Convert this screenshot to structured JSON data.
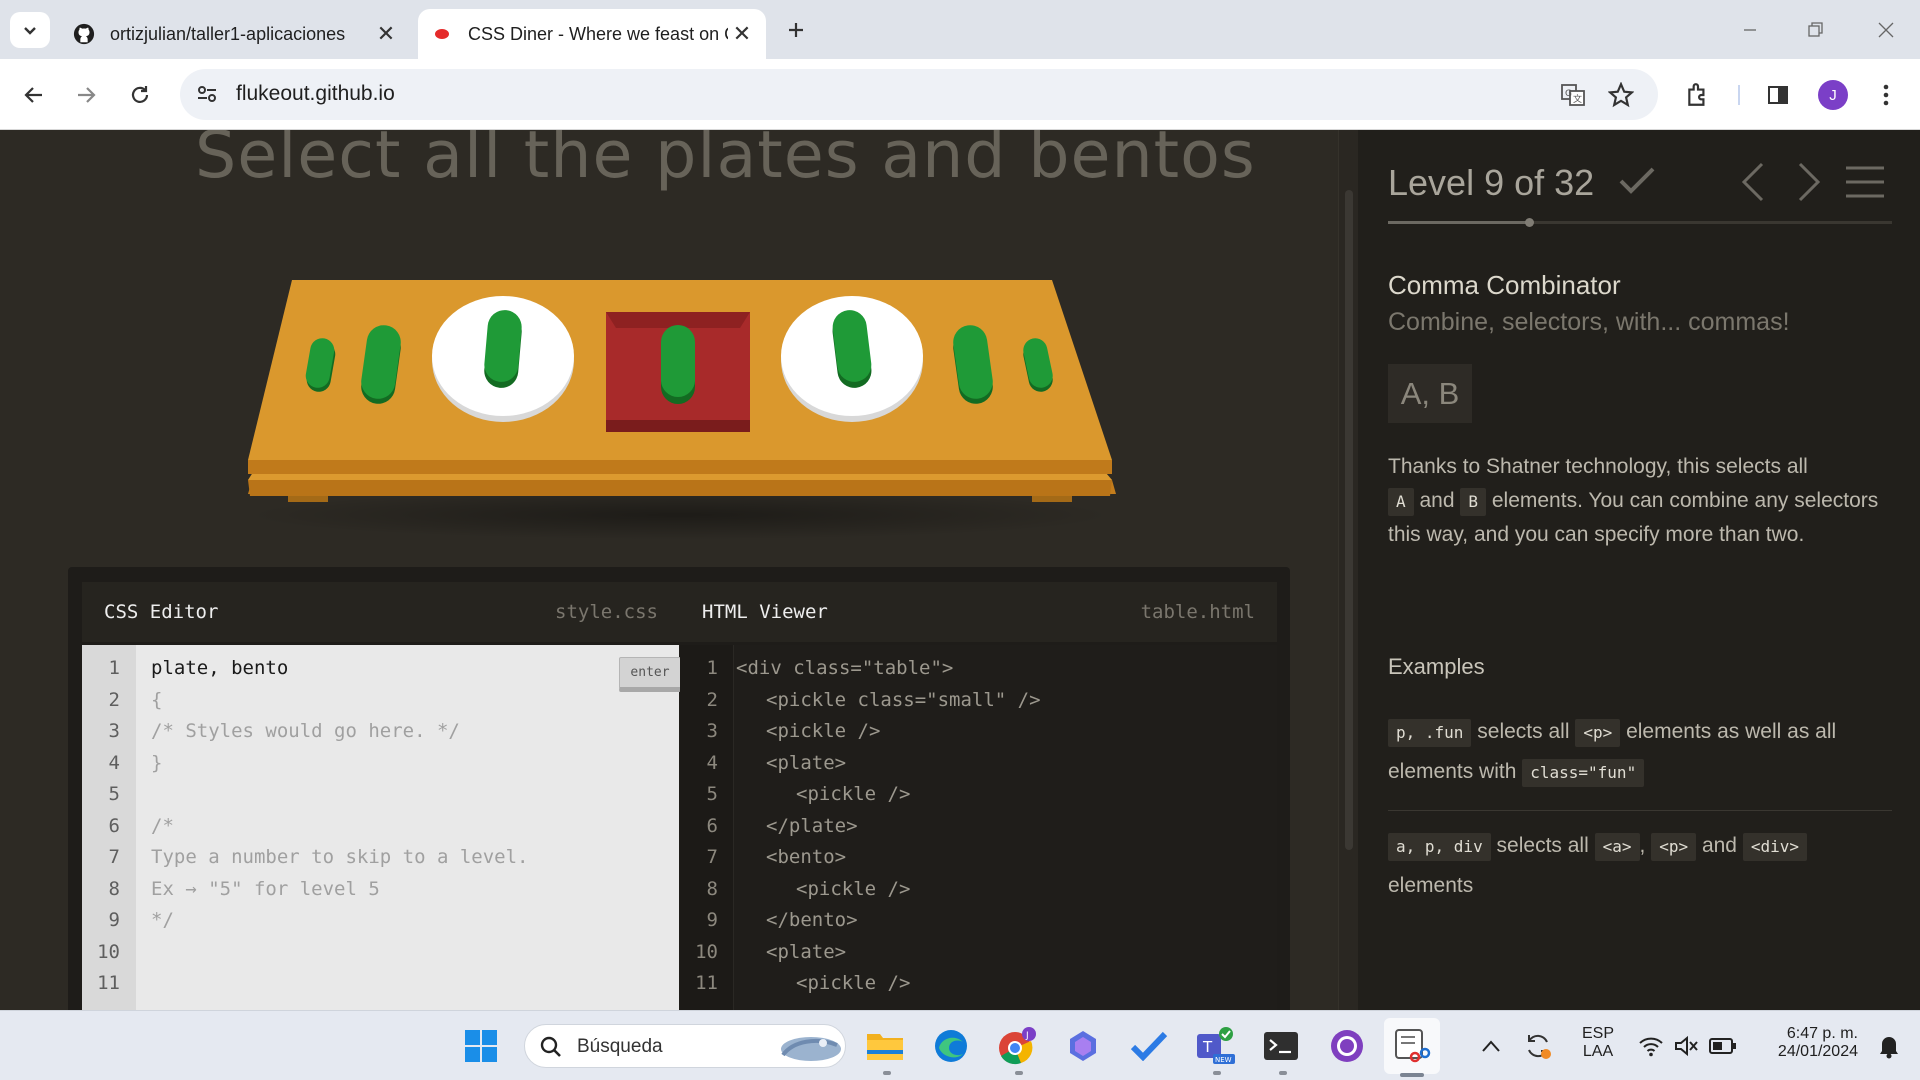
{
  "browser": {
    "tabs": [
      {
        "title": "ortizjulian/taller1-aplicaciones",
        "active": false,
        "icon": "github-icon"
      },
      {
        "title": "CSS Diner - Where we feast on CSS Selectors!",
        "active": true,
        "icon": "css-diner-icon"
      }
    ],
    "url": "flukeout.github.io",
    "profile_initial": "J"
  },
  "game": {
    "order_text": "Select all the plates and bentos",
    "table_items": [
      "pickle small",
      "pickle",
      "plate with pickle",
      "bento with pickle",
      "plate with pickle",
      "pickle",
      "pickle small"
    ],
    "css_editor": {
      "title": "CSS Editor",
      "file": "style.css",
      "enter_label": "enter",
      "lines": [
        {
          "n": "1",
          "text": "plate, bento"
        },
        {
          "n": "2",
          "text": "{"
        },
        {
          "n": "3",
          "text": "/* Styles would go here. */"
        },
        {
          "n": "4",
          "text": "}"
        },
        {
          "n": "5",
          "text": ""
        },
        {
          "n": "6",
          "text": "/*"
        },
        {
          "n": "7",
          "text": "Type a number to skip to a level."
        },
        {
          "n": "8",
          "text": "Ex → \"5\" for level 5"
        },
        {
          "n": "9",
          "text": "*/"
        },
        {
          "n": "10",
          "text": ""
        },
        {
          "n": "11",
          "text": ""
        }
      ]
    },
    "html_viewer": {
      "title": "HTML Viewer",
      "file": "table.html",
      "lines": [
        {
          "n": "1",
          "text": "<div class=\"table\">",
          "indent": 0
        },
        {
          "n": "2",
          "text": "<pickle class=\"small\" />",
          "indent": 1
        },
        {
          "n": "3",
          "text": "<pickle />",
          "indent": 1
        },
        {
          "n": "4",
          "text": "<plate>",
          "indent": 1
        },
        {
          "n": "5",
          "text": "<pickle />",
          "indent": 2
        },
        {
          "n": "6",
          "text": "</plate>",
          "indent": 1
        },
        {
          "n": "7",
          "text": "<bento>",
          "indent": 1
        },
        {
          "n": "8",
          "text": "<pickle />",
          "indent": 2
        },
        {
          "n": "9",
          "text": "</bento>",
          "indent": 1
        },
        {
          "n": "10",
          "text": "<plate>",
          "indent": 1
        },
        {
          "n": "11",
          "text": "<pickle />",
          "indent": 2
        }
      ]
    }
  },
  "sidebar": {
    "level_label": "Level 9 of 32",
    "completed": true,
    "progress": 0.28,
    "level_name": "Comma Combinator",
    "level_subtitle": "Combine, selectors, with... commas!",
    "syntax": "A, B",
    "description": {
      "p1": "Thanks to Shatner technology, this selects all",
      "code_a": "A",
      "and": "and",
      "code_b": "B",
      "p2": "elements. You can combine any selectors this way, and you can specify more than two."
    },
    "examples_heading": "Examples",
    "examples": [
      {
        "code1": "p, .fun",
        "t1": "selects all",
        "code2": "<p>",
        "t2": "elements as well as all elements with",
        "code3": "class=\"fun\""
      },
      {
        "code1": "a, p, div",
        "t1": "selects all",
        "code2": "<a>",
        "sep": ",",
        "code3": "<p>",
        "t2": "and",
        "code4": "<div>",
        "t3": "elements"
      }
    ]
  },
  "taskbar": {
    "search_placeholder": "Búsqueda",
    "language": "ESP",
    "language_sub": "LAA",
    "time": "6:47 p. m.",
    "date": "24/01/2024",
    "apps": [
      "windows-start-icon",
      "file-explorer-icon",
      "edge-icon",
      "chrome-icon",
      "copilot-icon",
      "todo-icon",
      "teams-icon",
      "terminal-icon",
      "github-desktop-icon",
      "snipping-tool-icon"
    ]
  },
  "colors": {
    "page_bg": "#2d2a24",
    "sidebar_bg": "#211f1b",
    "table_wood": "#d99a2f",
    "pickle_green": "#1e9a35",
    "bento_red": "#a82a2a"
  }
}
